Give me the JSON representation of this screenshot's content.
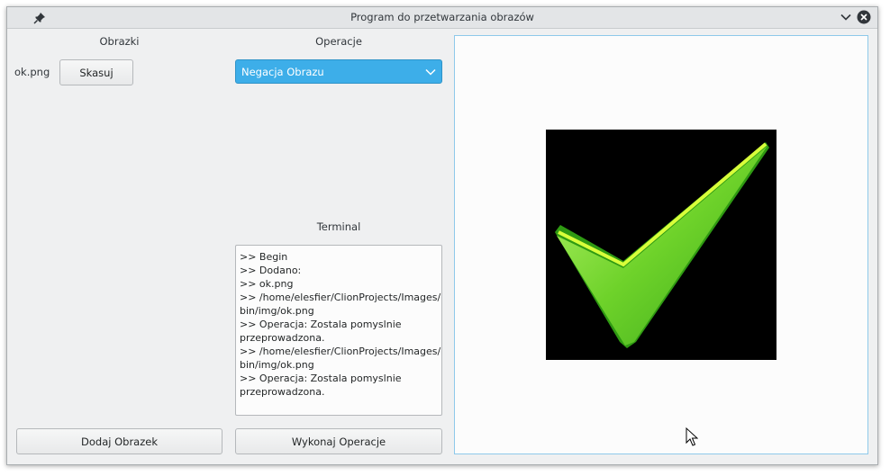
{
  "window": {
    "title": "Program do przetwarzania obrazów"
  },
  "images_panel": {
    "heading": "Obrazki",
    "items": [
      {
        "filename": "ok.png",
        "delete_label": "Skasuj"
      }
    ],
    "add_label": "Dodaj Obrazek"
  },
  "operations_panel": {
    "heading": "Operacje",
    "selected_operation": "Negacja Obrazu"
  },
  "terminal_panel": {
    "heading": "Terminal",
    "lines": [
      ">> Begin",
      ">> Dodano:",
      ">> ok.png",
      ">> /home/elesfier/ClionProjects/Images/",
      "bin/img/ok.png",
      ">> Operacja: Zostala pomyslnie",
      "przeprowadzona.",
      ">> /home/elesfier/ClionProjects/Images/",
      "bin/img/ok.png",
      ">> Operacja: Zostala pomyslnie",
      "przeprowadzona."
    ],
    "execute_label": "Wykonaj Operacje"
  },
  "preview": {
    "image_name": "ok.png",
    "image_icon": "green-checkmark-icon"
  },
  "colors": {
    "accent": "#3daee9",
    "image_background": "#000000",
    "checkmark": "#5fd31a"
  }
}
